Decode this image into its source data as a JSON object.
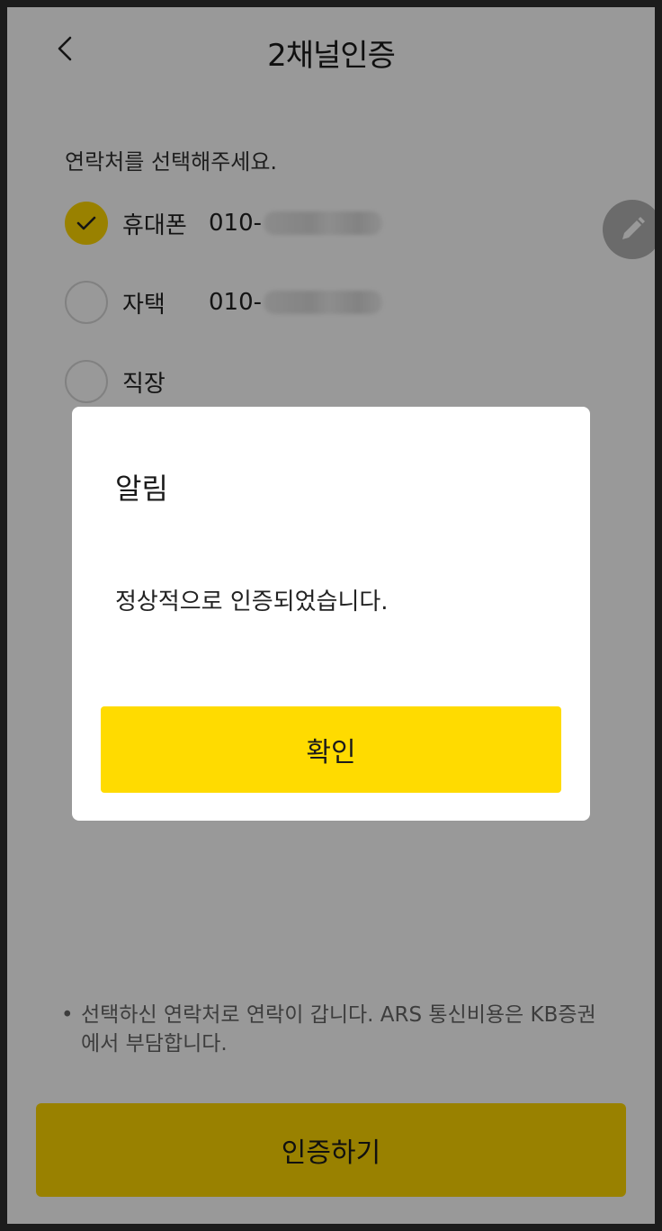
{
  "header": {
    "title": "2채널인증"
  },
  "prompt": "연락처를 선택해주세요.",
  "options": [
    {
      "label": "휴대폰",
      "phone_prefix": "010-",
      "checked": true
    },
    {
      "label": "자택",
      "phone_prefix": "010-",
      "checked": false
    },
    {
      "label": "직장",
      "phone_prefix": "",
      "checked": false
    }
  ],
  "notice": {
    "bullet": "•",
    "text": "선택하신 연락처로 연락이 갑니다. ARS 통신비용은 KB증권에서 부담합니다."
  },
  "bottom_button": {
    "label": "인증하기"
  },
  "modal": {
    "title": "알림",
    "message": "정상적으로 인증되었습니다.",
    "confirm_label": "확인"
  },
  "colors": {
    "accent": "#ffd800",
    "overlay": "rgba(0,0,0,0.40)"
  },
  "icons": {
    "back": "chevron-left-icon",
    "edit": "pencil-icon",
    "check": "check-icon"
  }
}
